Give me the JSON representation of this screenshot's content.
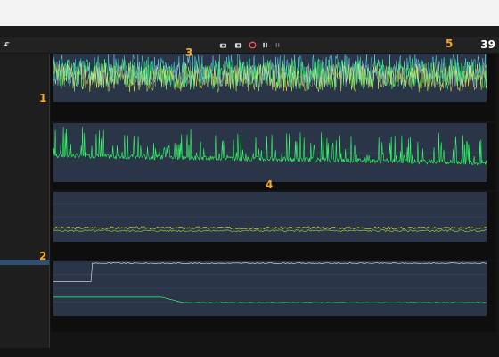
{
  "window": {
    "title": ""
  },
  "menubar": {
    "tab_label": "",
    "right_text": ""
  },
  "clock": {
    "label": "",
    "value": "39",
    "sub1": "",
    "sub2": ""
  },
  "annotations": [
    "1",
    "2",
    "3",
    "4",
    "5"
  ],
  "sidebar": {
    "metrics_header": "",
    "cpu_header": "",
    "cpu_items": [
      "",
      "",
      "",
      "",
      "",
      "",
      "",
      "",
      "",
      "",
      ""
    ],
    "render_header": "",
    "render_items": [
      "",
      "",
      "",
      "",
      "",
      "",
      "",
      "",
      "",
      "",
      "",
      "",
      "",
      "",
      "",
      "",
      "",
      "",
      "",
      "",
      ""
    ],
    "gpu_header": "",
    "gpu_items": [
      "",
      "",
      "",
      "",
      "",
      "",
      ""
    ],
    "overlays_header": "",
    "overlay_items": [
      "",
      "",
      "",
      "",
      "",
      "",
      "",
      "",
      "",
      "",
      "",
      "",
      "",
      "",
      "",
      ""
    ]
  },
  "graphs": [
    {
      "y_top": "",
      "y_mid": "",
      "y_bot": "",
      "stats": [
        {
          "name": "",
          "color": "#33ff66",
          "v1": "",
          "v2": "",
          "cur": ""
        },
        {
          "name": "",
          "color": "#eaeaea",
          "v1": "",
          "v2": "",
          "cur": ""
        },
        {
          "name": "",
          "color": "#f0ec4a",
          "v1": "",
          "v2": "",
          "cur": ""
        },
        {
          "name": "",
          "color": "#56d8e8",
          "v1": "",
          "v2": "",
          "cur": ""
        }
      ]
    },
    {
      "y_top": "",
      "y_bot": "",
      "stats": [
        {
          "name": "",
          "color": "#33ff66",
          "v1": "",
          "v2": "",
          "cur": ""
        }
      ]
    },
    {
      "y_top": "",
      "y_mid": "",
      "y_bot": "",
      "stats": [
        {
          "name": "",
          "color": "#9edc3a",
          "v1": "",
          "v2": "",
          "cur": ""
        },
        {
          "name": "",
          "color": "#e8e33a",
          "v1": "",
          "v2": "",
          "cur": ""
        }
      ]
    },
    {
      "y_top": "",
      "y_mid": "",
      "y_bot": "",
      "stats": [
        {
          "name": "",
          "color": "#33ff66",
          "v1": "",
          "v2": "",
          "cur": ""
        },
        {
          "name": "",
          "color": "#eaeaea",
          "v1": "",
          "v2": "",
          "cur": ""
        }
      ]
    }
  ]
}
